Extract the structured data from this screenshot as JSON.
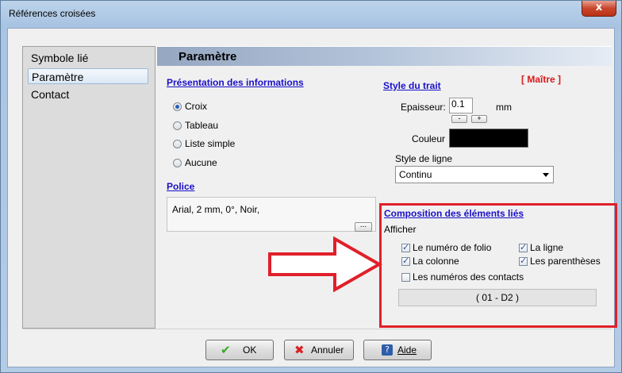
{
  "window": {
    "title": "Références croisées",
    "close_glyph": "x"
  },
  "sidebar": {
    "items": [
      {
        "label": "Symbole lié"
      },
      {
        "label": "Paramètre"
      },
      {
        "label": "Contact"
      }
    ],
    "selected": "Paramètre"
  },
  "main": {
    "title": "Paramètre",
    "master_badge": "[ Maître ]",
    "presentation": {
      "title": "Présentation des informations",
      "options": [
        {
          "label": "Croix",
          "checked": true
        },
        {
          "label": "Tableau",
          "checked": false
        },
        {
          "label": "Liste simple",
          "checked": false
        },
        {
          "label": "Aucune",
          "checked": false
        }
      ]
    },
    "police": {
      "title": "Police",
      "value": "Arial, 2 mm, 0°, Noir,",
      "button_label": "..."
    },
    "style_trait": {
      "title": "Style du trait",
      "epaisseur_label": "Epaisseur:",
      "epaisseur_value": "0.1",
      "epaisseur_unit": "mm",
      "minus_label": "-",
      "plus_label": "+",
      "couleur_label": "Couleur",
      "couleur_value": "#000000",
      "line_style_label": "Style de ligne",
      "line_style_value": "Continu"
    },
    "composition": {
      "title": "Composition des éléments liés",
      "afficher_label": "Afficher",
      "checkboxes": [
        {
          "label": "Le numéro de folio",
          "checked": true
        },
        {
          "label": "La ligne",
          "checked": true
        },
        {
          "label": "La colonne",
          "checked": true
        },
        {
          "label": "Les parenthèses",
          "checked": true
        },
        {
          "label": "Les numéros des contacts",
          "checked": false
        }
      ],
      "preview": "( 01 - D2 )"
    }
  },
  "buttons": {
    "ok": {
      "label": "OK",
      "icon": "checkmark-icon"
    },
    "cancel": {
      "label": "Annuler",
      "icon": "red-x-icon"
    },
    "help": {
      "label": "Aide",
      "icon": "help-icon"
    }
  },
  "colors": {
    "link_blue": "#1a10c8",
    "master_red": "#d71b1b",
    "highlight_red": "#e0202a"
  }
}
